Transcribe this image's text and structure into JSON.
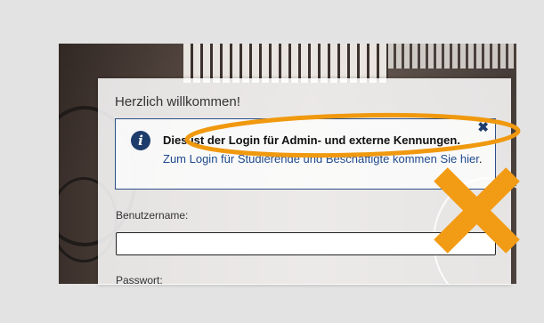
{
  "login": {
    "welcome_title": "Herzlich willkommen!",
    "info_message": "Dies ist der Login für Admin- und externe Kennungen.",
    "info_link_text": "Zum Login für Studierende und Beschäftigte kommen Sie hier",
    "info_link_suffix": ".",
    "info_icon_glyph": "i",
    "close_glyph": "✖",
    "username_label": "Benutzername:",
    "username_value": "",
    "password_label": "Passwort:"
  },
  "annotation": {
    "ellipse_color": "#f0990f",
    "cross_color": "#f29b14"
  }
}
